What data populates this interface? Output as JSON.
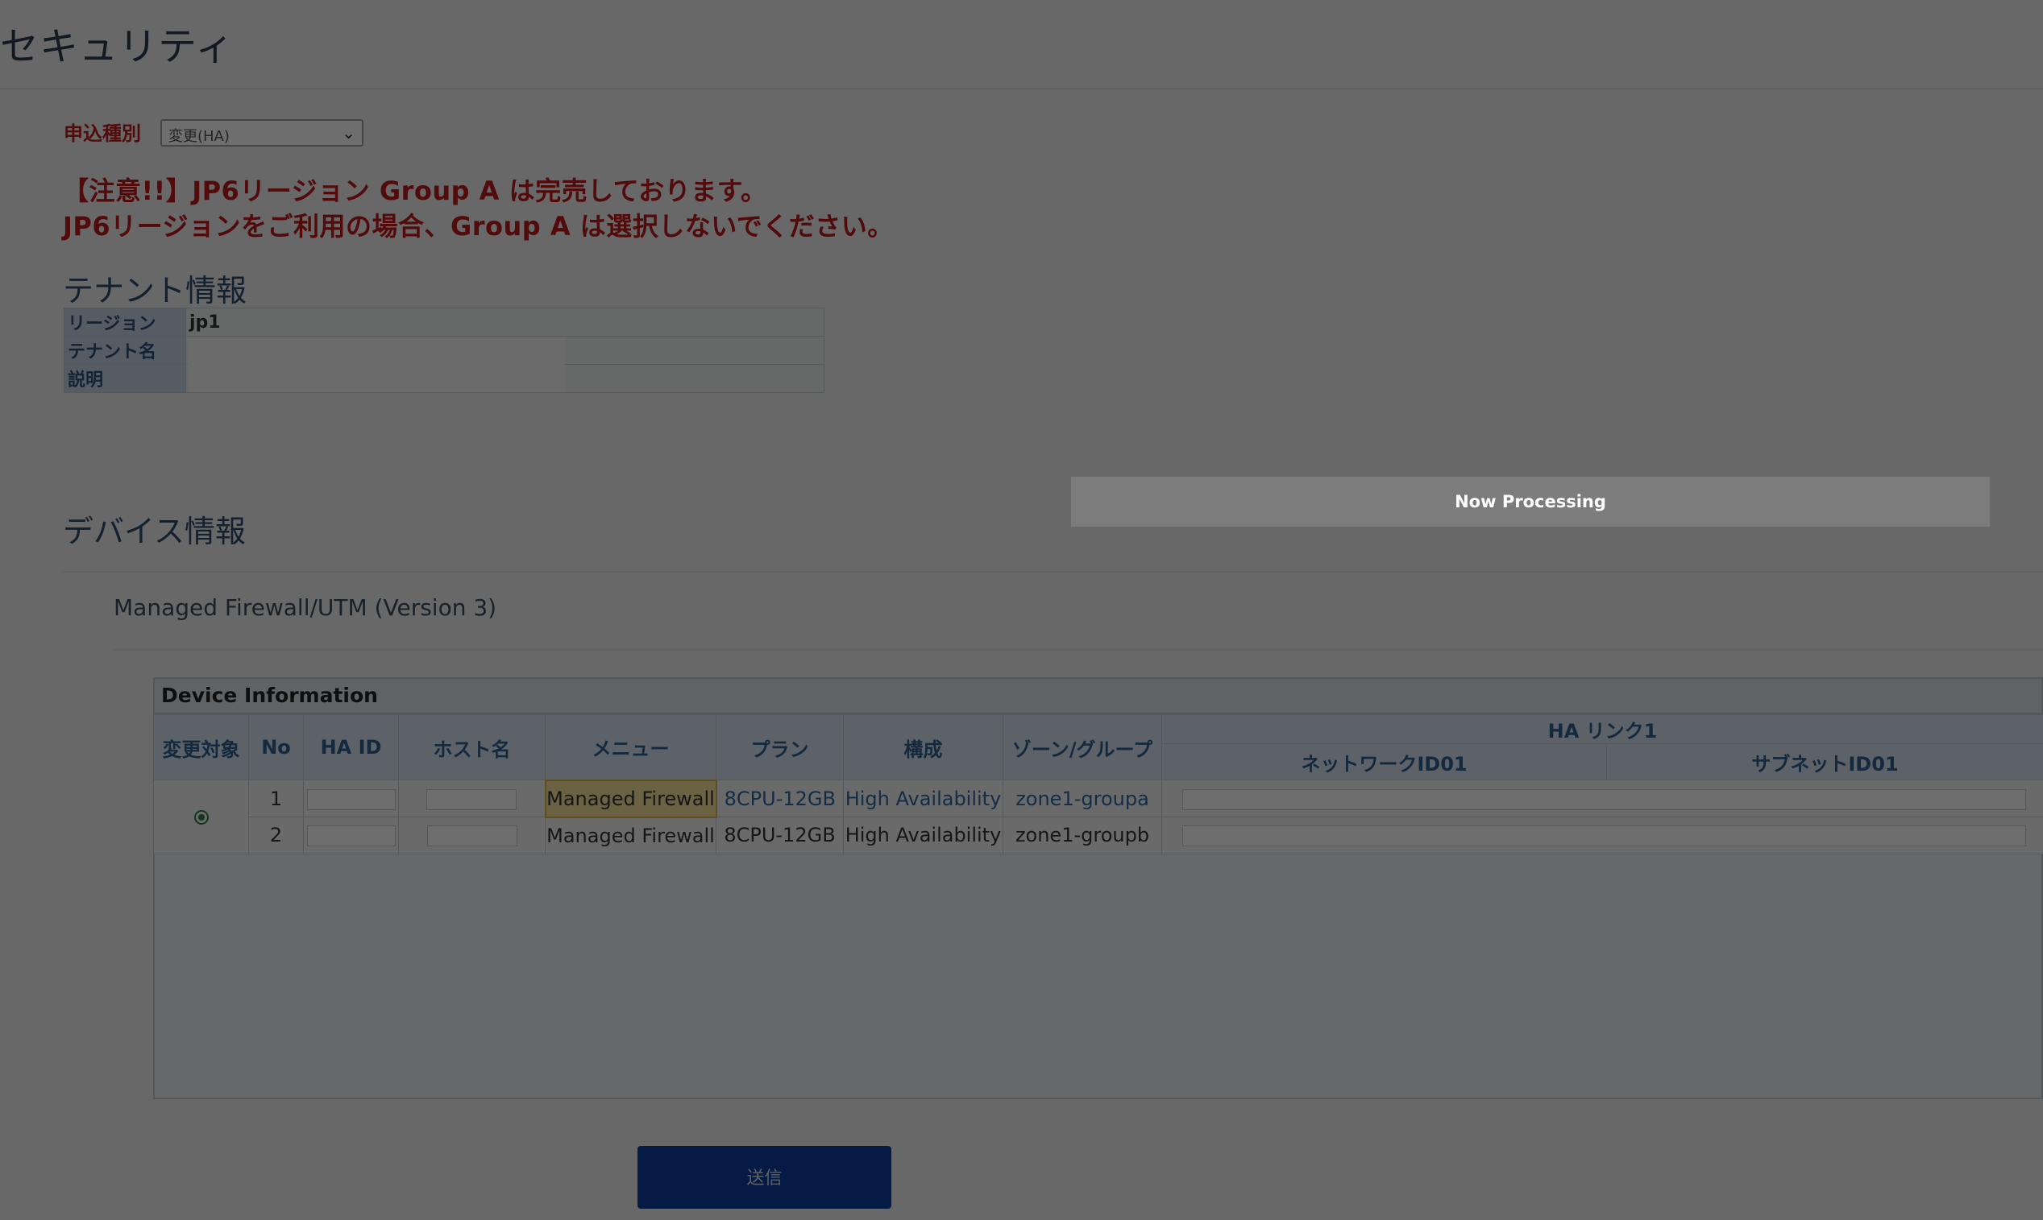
{
  "page": {
    "title": "セキュリティ"
  },
  "form": {
    "apply_type_label": "申込種別",
    "apply_type_value": "変更(HA)"
  },
  "notice": {
    "line1": "【注意!!】JP6リージョン Group A は完売しております。",
    "line2": "JP6リージョンをご利用の場合、Group A は選択しないでください。"
  },
  "tenant": {
    "section_title": "テナント情報",
    "rows": [
      {
        "label": "リージョン",
        "value": "jp1"
      },
      {
        "label": "テナント名",
        "value": ""
      },
      {
        "label": "説明",
        "value": ""
      }
    ]
  },
  "processing": {
    "text": "Now Processing"
  },
  "device": {
    "section_title": "デバイス情報",
    "product_name": "Managed Firewall/UTM (Version 3)",
    "box_title": "Device Information",
    "columns": {
      "target": "変更対象",
      "no": "No",
      "ha_id": "HA ID",
      "host": "ホスト名",
      "menu": "メニュー",
      "plan": "プラン",
      "config": "構成",
      "zone": "ゾーン/グループ",
      "ha_link": "HA リンク1",
      "network_id": "ネットワークID01",
      "subnet_id": "サブネットID01"
    },
    "rows": [
      {
        "no": "1",
        "menu": "Managed Firewall",
        "plan": "8CPU-12GB",
        "config": "High Availability",
        "zone": "zone1-groupa"
      },
      {
        "no": "2",
        "menu": "Managed Firewall",
        "plan": "8CPU-12GB",
        "config": "High Availability",
        "zone": "zone1-groupb"
      }
    ],
    "selected_radio": true
  },
  "actions": {
    "submit_label": "送信"
  },
  "colors": {
    "accent_red": "#c0191b",
    "header_blue": "#2f5f8f",
    "submit_blue": "#0d3d9e",
    "highlight_yellow": "#f6e49c",
    "overlay": "rgba(0,0,0,0.57)"
  }
}
